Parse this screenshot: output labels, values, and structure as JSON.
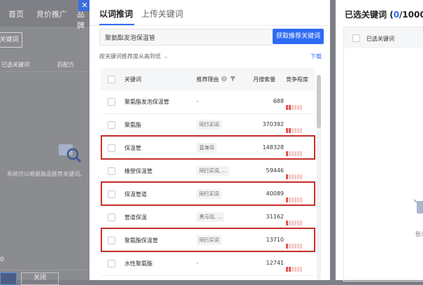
{
  "background": {
    "nav": [
      "首页",
      "竞价推广",
      "品牌"
    ],
    "add_keyword_button": "关键词",
    "table_headers": [
      "已选关键词",
      "匹配方"
    ],
    "empty_text": "系统可以根据商品推荐关键词。",
    "left_tag": "0",
    "confirm_button": "",
    "close_button": "关闭"
  },
  "modal": {
    "close_icon": "close-icon",
    "tabs": [
      {
        "label": "以词推词",
        "active": true
      },
      {
        "label": "上传关键词",
        "active": false
      }
    ],
    "search": {
      "value": "聚氨酯发泡保温管"
    },
    "fetch_button": "获取推荐关键词",
    "sort_label": "按关键词推荐度从高到低",
    "sort_caret": "⌄",
    "download_link": "下载",
    "table": {
      "headers": {
        "keyword": "关键词",
        "reason": "推荐理由",
        "volume": "月搜索量",
        "competition": "竞争程度"
      },
      "rows": [
        {
          "keyword": "聚氨酯发泡保温管",
          "reason": "-",
          "volume": "688",
          "competition": 2,
          "highlighted": false
        },
        {
          "keyword": "聚氨酯",
          "reason": "同行买词",
          "volume": "370392",
          "competition": 2,
          "highlighted": false
        },
        {
          "keyword": "保温管",
          "reason": "蓝海词",
          "volume": "148328",
          "competition": 1,
          "highlighted": true
        },
        {
          "keyword": "橡塑保温管",
          "reason": "同行买词, ...",
          "volume": "59446",
          "competition": 1,
          "highlighted": false
        },
        {
          "keyword": "保温管道",
          "reason": "同行买词",
          "volume": "40089",
          "competition": 1,
          "highlighted": true
        },
        {
          "keyword": "管道保温",
          "reason": "黑马词, ...",
          "volume": "31162",
          "competition": 1,
          "highlighted": false
        },
        {
          "keyword": "聚氨酯保温管",
          "reason": "同行买词",
          "volume": "13710",
          "competition": 1,
          "highlighted": true
        },
        {
          "keyword": "水性聚氨酯",
          "reason": "-",
          "volume": "12741",
          "competition": 2,
          "highlighted": false
        }
      ]
    }
  },
  "selected": {
    "title": "已选关键词",
    "count_open": "(",
    "count": "0",
    "count_total": "/1000)",
    "header_keyword": "已选关键词",
    "empty_text": "暂未"
  },
  "colors": {
    "primary": "#2f6cf6",
    "highlight": "#c8302c",
    "competition_on": "#e4534c",
    "competition_off": "#f5c8c6"
  }
}
